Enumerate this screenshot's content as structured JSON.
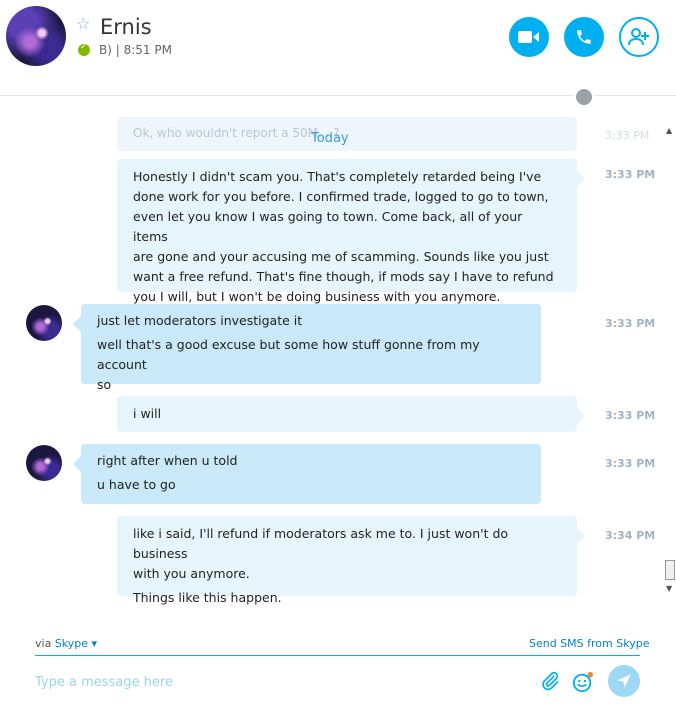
{
  "contact": {
    "name": "Ernis",
    "status_text": "B) | 8:51 PM"
  },
  "colors": {
    "accent": "#00aff0",
    "outgoing_bubble": "#e6f4fc",
    "incoming_bubble": "#c9e8f8",
    "online": "#7fba00"
  },
  "header": {
    "icons": [
      "video-call-icon",
      "audio-call-icon",
      "add-people-icon",
      "favorite-star-icon",
      "globe-icon"
    ]
  },
  "chat": {
    "previous_message_fragment": "Ok, who wouldn't report a 50M... ?",
    "previous_time": "3:33 PM",
    "date_divider": "Today",
    "messages": [
      {
        "direction": "outgoing",
        "lines": [
          "Honestly I didn't scam you. That's completely retarded being I've",
          "done work for you before. I confirmed trade, logged to go to town,",
          "even let you know I was going to town. Come back, all of your items",
          "are gone and your accusing me of scamming. Sounds like you just",
          "want a free refund. That's fine though, if mods say I have to refund",
          "you I will, but I won't be doing business with you anymore."
        ],
        "time": "3:33 PM"
      },
      {
        "direction": "incoming",
        "lines": [
          "just let moderators investigate it",
          "well that's a good excuse but some how stuff gonne from my account",
          "so"
        ],
        "time": "3:33 PM"
      },
      {
        "direction": "outgoing",
        "lines": [
          "i will"
        ],
        "time": "3:33 PM"
      },
      {
        "direction": "incoming",
        "lines": [
          "right after when u told",
          "u have to go"
        ],
        "time": "3:33 PM"
      },
      {
        "direction": "outgoing",
        "lines": [
          "like i said, I'll refund if moderators ask me to. I just won't do business",
          "with you anymore.",
          "Things like this happen."
        ],
        "time": "3:34 PM"
      }
    ]
  },
  "footer": {
    "via_label": "via",
    "via_service": "Skype",
    "sms_link": "Send SMS from Skype",
    "input_placeholder": "Type a message here"
  }
}
